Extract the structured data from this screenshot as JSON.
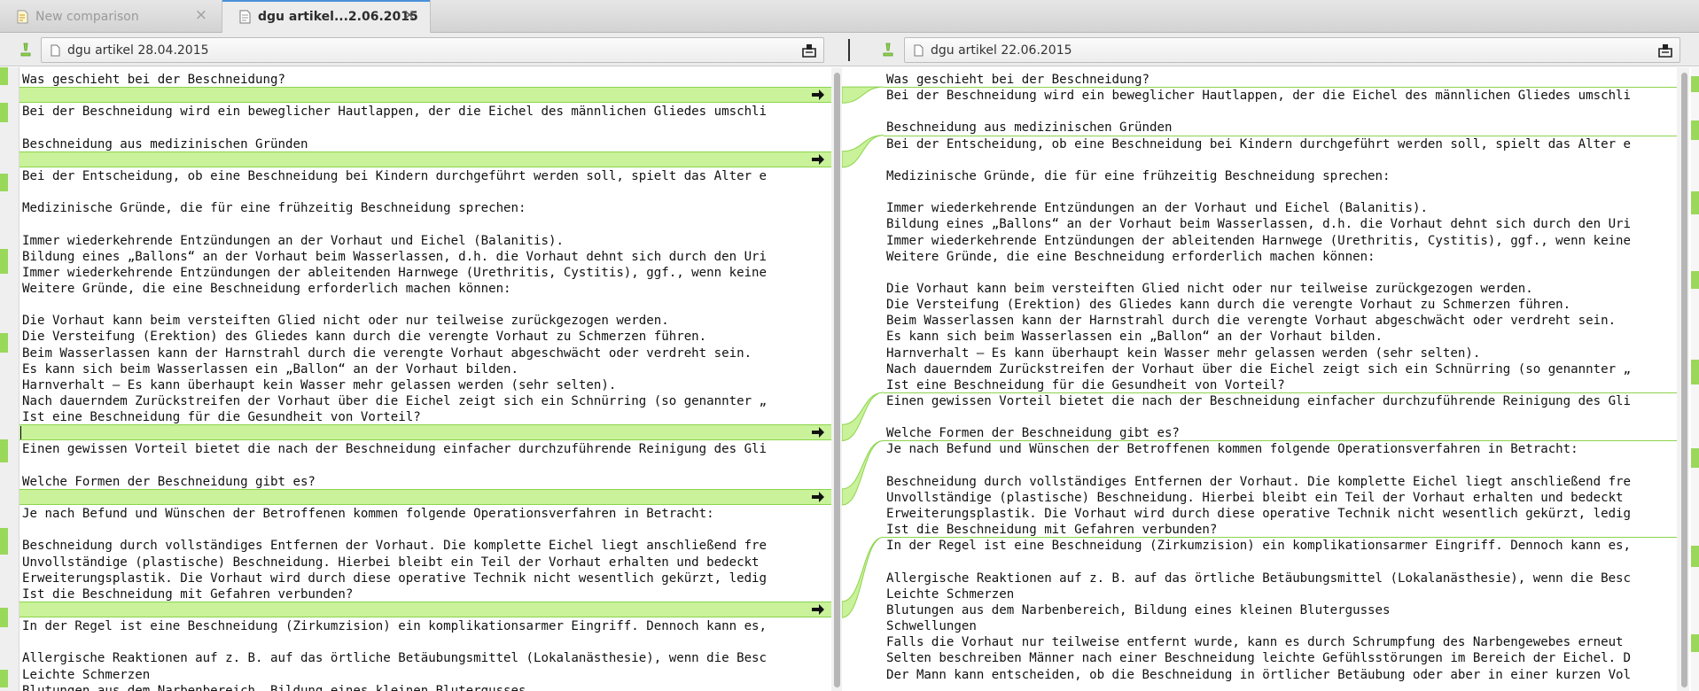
{
  "tabs": [
    {
      "label": "New comparison",
      "close": "×",
      "icon": "comparison-icon",
      "active": false
    },
    {
      "label": "dgu artikel...2.06.2015",
      "close": "×",
      "icon": "document-icon",
      "active": true
    }
  ],
  "left_file": {
    "path": "dgu artikel 28.04.2015"
  },
  "right_file": {
    "path": "dgu artikel 22.06.2015"
  },
  "colors": {
    "insert_bg": "#c9f29a",
    "insert_border": "#8cd44c",
    "accent": "#4a90d9"
  },
  "left_lines": [
    "Was geschieht bei der Beschneidung?",
    "",
    "Bei der Beschneidung wird ein beweglicher Hautlappen, der die Eichel des männlichen Gliedes umschli",
    "",
    "Beschneidung aus medizinischen Gründen",
    "",
    "Bei der Entscheidung, ob eine Beschneidung bei Kindern durchgeführt werden soll, spielt das Alter e",
    "",
    "Medizinische Gründe, die für eine frühzeitig Beschneidung sprechen:",
    "",
    "Immer wiederkehrende Entzündungen an der Vorhaut und Eichel (Balanitis).",
    "Bildung eines „Ballons“ an der Vorhaut beim Wasserlassen, d.h. die Vorhaut dehnt sich durch den Uri",
    "Immer wiederkehrende Entzündungen der ableitenden Harnwege (Urethritis, Cystitis), ggf., wenn keine",
    "Weitere Gründe, die eine Beschneidung erforderlich machen können:",
    "",
    "Die Vorhaut kann beim versteiften Glied nicht oder nur teilweise zurückgezogen werden.",
    "Die Versteifung (Erektion) des Gliedes kann durch die verengte Vorhaut zu Schmerzen führen.",
    "Beim Wasserlassen kann der Harnstrahl durch die verengte Vorhaut abgeschwächt oder verdreht sein.",
    "Es kann sich beim Wasserlassen ein „Ballon“ an der Vorhaut bilden.",
    "Harnverhalt – Es kann überhaupt kein Wasser mehr gelassen werden (sehr selten).",
    "Nach dauerndem Zurückstreifen der Vorhaut über die Eichel zeigt sich ein Schnürring (so genannter „",
    "Ist eine Beschneidung für die Gesundheit von Vorteil?",
    "",
    "Einen gewissen Vorteil bietet die nach der Beschneidung einfacher durchzuführende Reinigung des Gli",
    "",
    "Welche Formen der Beschneidung gibt es?",
    "",
    "Je nach Befund und Wünschen der Betroffenen kommen folgende Operationsverfahren in Betracht:",
    "",
    "Beschneidung durch vollständiges Entfernen der Vorhaut. Die komplette Eichel liegt anschließend fre",
    "Unvollständige (plastische) Beschneidung. Hierbei bleibt ein Teil der Vorhaut erhalten und bedeckt",
    "Erweiterungsplastik. Die Vorhaut wird durch diese operative Technik nicht wesentlich gekürzt, ledig",
    "Ist die Beschneidung mit Gefahren verbunden?",
    "",
    "In der Regel ist eine Beschneidung (Zirkumzision) ein komplikationsarmer Eingriff. Dennoch kann es,",
    "",
    "Allergische Reaktionen auf z. B. auf das örtliche Betäubungsmittel (Lokalanästhesie), wenn die Besc",
    "Leichte Schmerzen",
    "Blutungen aus dem Narbenbereich, Bildung eines kleinen Blutergusses"
  ],
  "right_lines": [
    "Was geschieht bei der Beschneidung?",
    "Bei der Beschneidung wird ein beweglicher Hautlappen, der die Eichel des männlichen Gliedes umschli",
    "",
    "Beschneidung aus medizinischen Gründen",
    "Bei der Entscheidung, ob eine Beschneidung bei Kindern durchgeführt werden soll, spielt das Alter e",
    "",
    "Medizinische Gründe, die für eine frühzeitig Beschneidung sprechen:",
    "",
    "Immer wiederkehrende Entzündungen an der Vorhaut und Eichel (Balanitis).",
    "Bildung eines „Ballons“ an der Vorhaut beim Wasserlassen, d.h. die Vorhaut dehnt sich durch den Uri",
    "Immer wiederkehrende Entzündungen der ableitenden Harnwege (Urethritis, Cystitis), ggf., wenn keine",
    "Weitere Gründe, die eine Beschneidung erforderlich machen können:",
    "",
    "Die Vorhaut kann beim versteiften Glied nicht oder nur teilweise zurückgezogen werden.",
    "Die Versteifung (Erektion) des Gliedes kann durch die verengte Vorhaut zu Schmerzen führen.",
    "Beim Wasserlassen kann der Harnstrahl durch die verengte Vorhaut abgeschwächt oder verdreht sein.",
    "Es kann sich beim Wasserlassen ein „Ballon“ an der Vorhaut bilden.",
    "Harnverhalt – Es kann überhaupt kein Wasser mehr gelassen werden (sehr selten).",
    "Nach dauerndem Zurückstreifen der Vorhaut über die Eichel zeigt sich ein Schnürring (so genannter „",
    "Ist eine Beschneidung für die Gesundheit von Vorteil?",
    "Einen gewissen Vorteil bietet die nach der Beschneidung einfacher durchzuführende Reinigung des Gli",
    "",
    "Welche Formen der Beschneidung gibt es?",
    "Je nach Befund und Wünschen der Betroffenen kommen folgende Operationsverfahren in Betracht:",
    "",
    "Beschneidung durch vollständiges Entfernen der Vorhaut. Die komplette Eichel liegt anschließend fre",
    "Unvollständige (plastische) Beschneidung. Hierbei bleibt ein Teil der Vorhaut erhalten und bedeckt",
    "Erweiterungsplastik. Die Vorhaut wird durch diese operative Technik nicht wesentlich gekürzt, ledig",
    "Ist die Beschneidung mit Gefahren verbunden?",
    "In der Regel ist eine Beschneidung (Zirkumzision) ein komplikationsarmer Eingriff. Dennoch kann es,",
    "",
    "Allergische Reaktionen auf z. B. auf das örtliche Betäubungsmittel (Lokalanästhesie), wenn die Besc",
    "Leichte Schmerzen",
    "Blutungen aus dem Narbenbereich, Bildung eines kleinen Blutergusses",
    "Schwellungen",
    "Falls die Vorhaut nur teilweise entfernt wurde, kann es durch Schrumpfung des Narbengewebes erneut",
    "Selten beschreiben Männer nach einer Beschneidung leichte Gefühlsstörungen im Bereich der Eichel. D",
    "Der Mann kann entscheiden, ob die Beschneidung in örtlicher Betäubung oder aber in einer kurzen Vol"
  ],
  "left_chunks": [
    1,
    5,
    22,
    26,
    33
  ],
  "right_links": [
    1,
    4,
    20,
    23,
    29
  ]
}
